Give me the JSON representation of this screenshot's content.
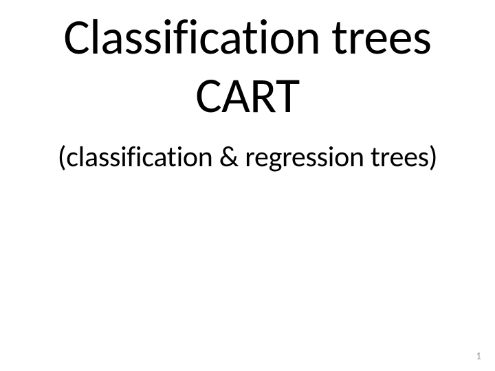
{
  "slide": {
    "title_line1": "Classification trees",
    "title_line2": "CART",
    "subtitle": "(classification & regression trees)",
    "page_number": "1"
  }
}
